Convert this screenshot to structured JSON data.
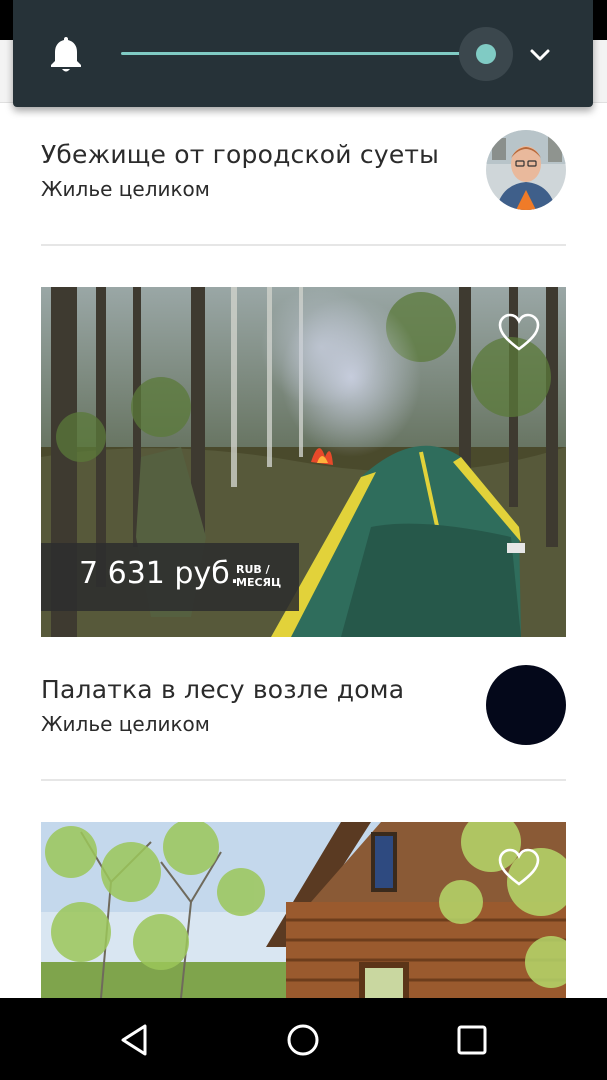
{
  "volume_panel": {
    "icons": {
      "bell": "bell-icon",
      "expand": "chevron-down-icon"
    },
    "slider_level": 1.0,
    "colors": {
      "panel": "#263238",
      "accent": "#80cbc4"
    }
  },
  "listings": [
    {
      "title": "Убежище от городской суеты",
      "subtitle": "Жилье целиком"
    },
    {
      "title": "Палатка в лесу возле дома",
      "subtitle": "Жилье целиком",
      "price": "7 631 руб.",
      "price_currency": "RUB /",
      "price_period": "МЕСЯЦ",
      "favorite_icon": "heart-outline-icon"
    },
    {
      "favorite_icon": "heart-outline-icon"
    }
  ],
  "navbar": {
    "icons": [
      "back-triangle-icon",
      "home-circle-icon",
      "recents-square-icon"
    ]
  }
}
